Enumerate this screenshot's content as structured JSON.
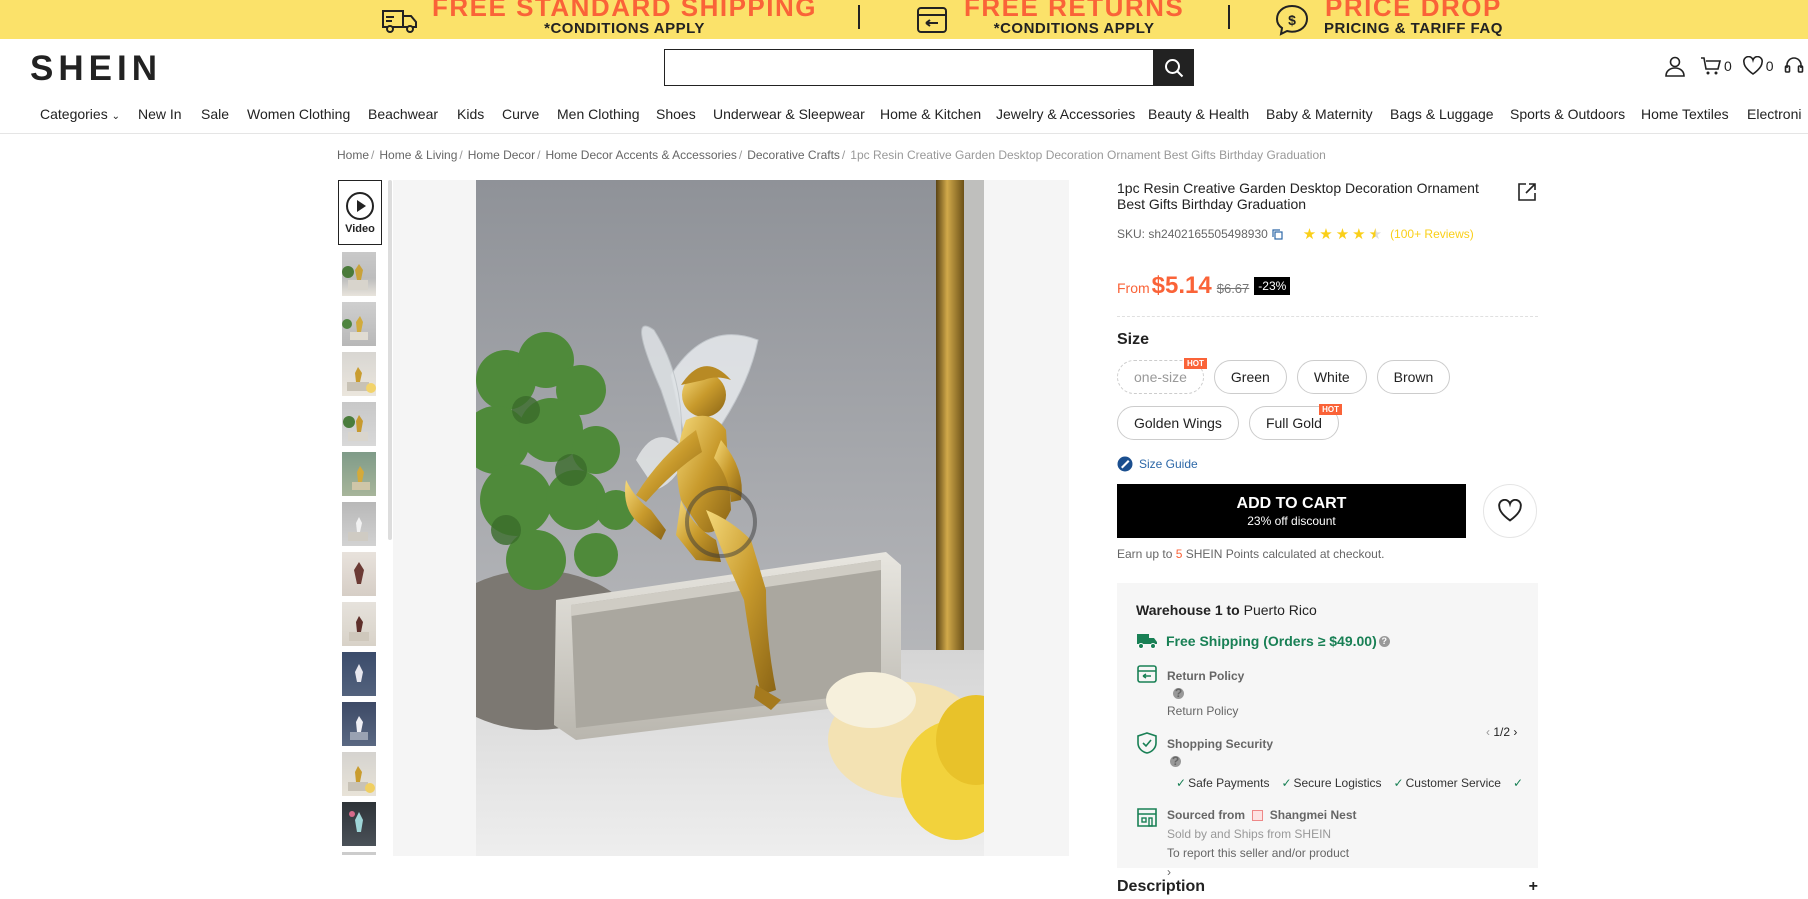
{
  "promo": {
    "items": [
      {
        "main": "FREE STANDARD SHIPPING",
        "sub": "*CONDITIONS APPLY",
        "icon": "truck-icon"
      },
      {
        "main": "FREE RETURNS",
        "sub": "*CONDITIONS APPLY",
        "icon": "return-box-icon"
      },
      {
        "main": "PRICE DROP",
        "sub": "PRICING & TARIFF FAQ",
        "icon": "chat-dollar-icon"
      }
    ]
  },
  "header": {
    "logo": "SHEIN",
    "search_value": "",
    "cart_count": "0",
    "wishlist_count": "0"
  },
  "nav": [
    "Categories",
    "New In",
    "Sale",
    "Women Clothing",
    "Beachwear",
    "Kids",
    "Curve",
    "Men Clothing",
    "Shoes",
    "Underwear & Sleepwear",
    "Home & Kitchen",
    "Jewelry & Accessories",
    "Beauty & Health",
    "Baby & Maternity",
    "Bags & Luggage",
    "Sports & Outdoors",
    "Home Textiles",
    "Electroni"
  ],
  "breadcrumb": [
    "Home",
    "Home & Living",
    "Home Decor",
    "Home Decor Accents & Accessories",
    "Decorative Crafts",
    "1pc Resin Creative Garden Desktop Decoration Ornament Best Gifts Birthday Graduation"
  ],
  "gallery": {
    "video_label": "Video"
  },
  "product": {
    "title": "1pc Resin Creative Garden Desktop Decoration Ornament Best Gifts Birthday Graduation",
    "sku": "SKU: sh2402165505498930",
    "rating": 4.5,
    "reviews": "(100+ Reviews)",
    "from_label": "From",
    "price": "$5.14",
    "old_price": "$6.67",
    "discount": "-23%",
    "size_label": "Size",
    "options": [
      {
        "label": "one-size",
        "hot": true,
        "disabled": true
      },
      {
        "label": "Green",
        "hot": false,
        "disabled": false
      },
      {
        "label": "White",
        "hot": false,
        "disabled": false
      },
      {
        "label": "Brown",
        "hot": false,
        "disabled": false
      },
      {
        "label": "Golden Wings",
        "hot": false,
        "disabled": false
      },
      {
        "label": "Full Gold",
        "hot": true,
        "disabled": false
      }
    ],
    "hot_label": "HOT",
    "size_guide": "Size Guide",
    "add_to_cart": "ADD TO CART",
    "cart_sub": "23% off discount",
    "points_pre": "Earn up to",
    "points_num": "5",
    "points_post": "SHEIN Points calculated at checkout."
  },
  "shipping": {
    "warehouse_bold": "Warehouse 1 to",
    "destination": "Puerto Rico",
    "free_shipping": "Free Shipping (Orders ≥ $49.00)",
    "return_title": "Return Policy",
    "return_sub": "Return Policy",
    "security_title": "Shopping Security",
    "security_page": "1/2",
    "security_items": [
      "Safe Payments",
      "Secure Logistics",
      "Customer Service"
    ],
    "sourced_label": "Sourced from",
    "seller": "Shangmei Nest",
    "sold_by": "Sold by and Ships from SHEIN",
    "report": "To report this seller and/or product"
  },
  "description": {
    "label": "Description",
    "toggle": "+"
  },
  "colors": {
    "accent": "#fa6338",
    "banner": "#fbe26a",
    "green": "#198055",
    "star": "#facf19"
  }
}
